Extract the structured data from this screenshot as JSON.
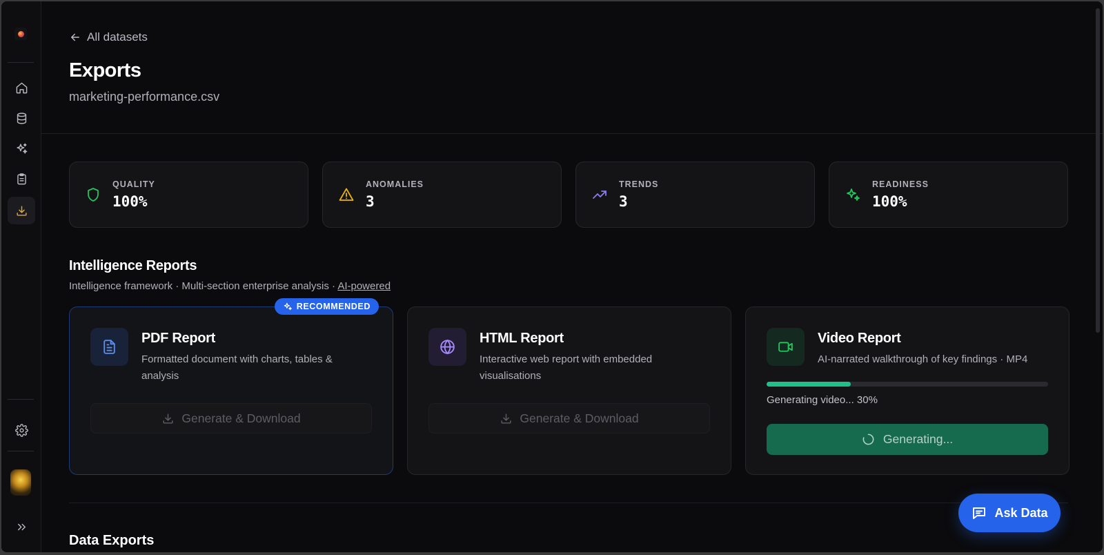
{
  "nav": {
    "back_label": "All datasets",
    "items": [
      "home-icon",
      "database-icon",
      "sparkles-icon",
      "clipboard-icon",
      "download-icon",
      "settings-icon",
      "expand-icon"
    ],
    "active_item": "download-icon"
  },
  "header": {
    "title": "Exports",
    "subtitle": "marketing-performance.csv"
  },
  "stats": [
    {
      "label": "QUALITY",
      "value": "100%",
      "icon": "shield-icon",
      "color": "#22c55e"
    },
    {
      "label": "ANOMALIES",
      "value": "3",
      "icon": "warning-icon",
      "color": "#eab308"
    },
    {
      "label": "TRENDS",
      "value": "3",
      "icon": "trending-up-icon",
      "color": "#8b7cf6"
    },
    {
      "label": "READINESS",
      "value": "100%",
      "icon": "sparkles-icon",
      "color": "#22c55e"
    }
  ],
  "intelligence": {
    "title": "Intelligence Reports",
    "subtitle_prefix": "Intelligence framework · Multi-section enterprise analysis · ",
    "subtitle_link": "AI-powered",
    "reports": [
      {
        "title": "PDF Report",
        "description": "Formatted document with charts, tables & analysis",
        "badge": "RECOMMENDED",
        "button": "Generate & Download",
        "icon": "document-icon",
        "icon_color": "#5b8def"
      },
      {
        "title": "HTML Report",
        "description": "Interactive web report with embedded visualisations",
        "button": "Generate & Download",
        "icon": "globe-icon",
        "icon_color": "#a78bfa"
      },
      {
        "title": "Video Report",
        "description": "AI-narrated walkthrough of key findings · MP4",
        "progress": 0.3,
        "progress_text": "Generating video... 30%",
        "button": "Generating...",
        "icon": "video-icon",
        "icon_color": "#22c55e"
      }
    ]
  },
  "data_exports": {
    "title": "Data Exports"
  },
  "ask_button": "Ask Data"
}
